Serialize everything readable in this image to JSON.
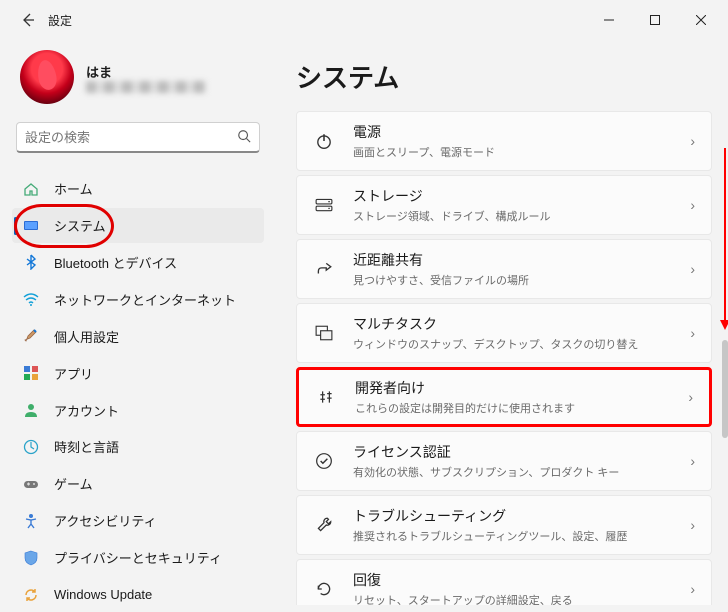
{
  "window": {
    "title": "設定"
  },
  "profile": {
    "name": "はま",
    "sub_placeholder": "████████"
  },
  "search": {
    "placeholder": "設定の検索"
  },
  "nav": [
    {
      "id": "home",
      "label": "ホーム"
    },
    {
      "id": "system",
      "label": "システム"
    },
    {
      "id": "bluetooth",
      "label": "Bluetooth とデバイス"
    },
    {
      "id": "network",
      "label": "ネットワークとインターネット"
    },
    {
      "id": "personal",
      "label": "個人用設定"
    },
    {
      "id": "apps",
      "label": "アプリ"
    },
    {
      "id": "accounts",
      "label": "アカウント"
    },
    {
      "id": "time",
      "label": "時刻と言語"
    },
    {
      "id": "gaming",
      "label": "ゲーム"
    },
    {
      "id": "access",
      "label": "アクセシビリティ"
    },
    {
      "id": "privacy",
      "label": "プライバシーとセキュリティ"
    },
    {
      "id": "update",
      "label": "Windows Update"
    }
  ],
  "nav_selected": "system",
  "main": {
    "heading": "システム",
    "items": [
      {
        "id": "power",
        "title": "電源",
        "desc": "画面とスリープ、電源モード"
      },
      {
        "id": "storage",
        "title": "ストレージ",
        "desc": "ストレージ領域、ドライブ、構成ルール"
      },
      {
        "id": "nearby",
        "title": "近距離共有",
        "desc": "見つけやすさ、受信ファイルの場所"
      },
      {
        "id": "multi",
        "title": "マルチタスク",
        "desc": "ウィンドウのスナップ、デスクトップ、タスクの切り替え"
      },
      {
        "id": "dev",
        "title": "開発者向け",
        "desc": "これらの設定は開発目的だけに使用されます",
        "highlight": true
      },
      {
        "id": "license",
        "title": "ライセンス認証",
        "desc": "有効化の状態、サブスクリプション、プロダクト キー"
      },
      {
        "id": "trouble",
        "title": "トラブルシューティング",
        "desc": "推奨されるトラブルシューティングツール、設定、履歴"
      },
      {
        "id": "recovery",
        "title": "回復",
        "desc": "リセット、スタートアップの詳細設定、戻る"
      }
    ]
  }
}
